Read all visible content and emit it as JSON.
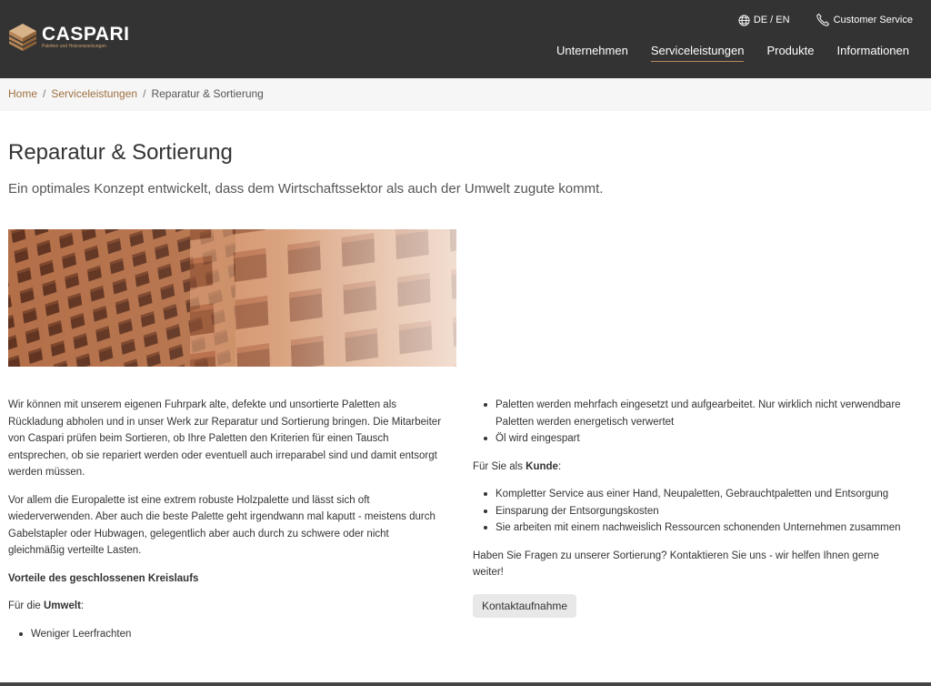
{
  "header": {
    "logo_name": "CASPARI",
    "logo_tagline": "Paletten und Holzverpackungen",
    "lang_label": "DE / EN",
    "customer_service": "Customer Service",
    "nav": [
      {
        "label": "Unternehmen",
        "active": false
      },
      {
        "label": "Serviceleistungen",
        "active": true
      },
      {
        "label": "Produkte",
        "active": false
      },
      {
        "label": "Informationen",
        "active": false
      }
    ],
    "colors": {
      "bar": "#333333",
      "accent": "#b5895a"
    }
  },
  "breadcrumb": {
    "home": "Home",
    "section": "Serviceleistungen",
    "current": "Reparatur & Sortierung",
    "separator": "/"
  },
  "page": {
    "title": "Reparatur & Sortierung",
    "subtitle": "Ein optimales Konzept entwickelt, dass dem Wirtschaftssektor als auch der Umwelt zugute kommt."
  },
  "left": {
    "p1": "Wir können mit unserem eigenen Fuhrpark alte, defekte und unsortierte Paletten als Rückladung abholen und in unser Werk zur Reparatur und Sortierung bringen. Die Mitarbeiter von Caspari prüfen beim Sortieren, ob Ihre Paletten den Kriterien für einen Tausch entsprechen, ob sie repariert werden oder eventuell auch irreparabel sind und damit entsorgt werden müssen.",
    "p2": "Vor allem die Europalette ist eine extrem robuste Holzpalette und lässt sich oft wiederverwenden. Aber auch die beste Palette geht irgendwann mal kaputt - meistens durch Gabelstapler oder Hubwagen, gelegentlich aber auch durch zu schwere oder nicht gleichmäßig verteilte Lasten.",
    "heading": "Vorteile des geschlossenen Kreislaufs",
    "for_prefix": "Für die ",
    "for_bold": "Umwelt",
    "for_suffix": ":",
    "items": [
      "Weniger Leerfrachten"
    ]
  },
  "right": {
    "items_top": [
      "Paletten werden mehrfach eingesetzt und aufgearbeitet. Nur wirklich nicht verwendbare Paletten werden energetisch verwertet",
      "Öl wird eingespart"
    ],
    "for_prefix": "Für Sie als ",
    "for_bold": "Kunde",
    "for_suffix": ":",
    "items_customer": [
      "Kompletter Service aus einer Hand, Neupaletten, Gebrauchtpaletten und Entsorgung",
      "Einsparung der Entsorgungskosten",
      "Sie arbeiten mit einem nachweislich Ressourcen schonenden Unternehmen zusammen"
    ],
    "question": "Haben Sie Fragen zu unserer Sortierung? Kontaktieren Sie uns - wir helfen Ihnen gerne weiter!",
    "button": "Kontaktaufnahme"
  },
  "icons": {
    "logo": "pallet-stack-logo",
    "lang": "globe-icon",
    "phone": "phone-icon"
  }
}
